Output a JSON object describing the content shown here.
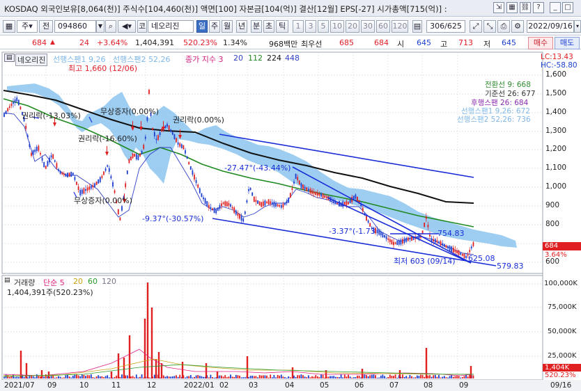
{
  "title_bar": {
    "text": "KOSDAQ 외국인보유[8,064(천)] 주식수[104,460(천)] 액면[100] 자본금[104(억)] 결산[12월] EPS[-27] 시가총액[715(억)] :",
    "icons": [
      "export-icon",
      "table-icon",
      "link-icon",
      "print-icon",
      "help-icon",
      "minimize-icon",
      "maximize-icon",
      "close-icon"
    ]
  },
  "toolbar": {
    "market_select": "주",
    "prev_label": "전",
    "code": "094860",
    "stock_prefix": "코",
    "stock_name": "네오리진",
    "periods": [
      "일",
      "주",
      "월",
      "년",
      "분",
      "초",
      "틱"
    ],
    "intervals": [
      "1",
      "3",
      "5",
      "10",
      "20",
      "30",
      "60",
      "120"
    ],
    "page_count": "306/625",
    "date": "2022/09/16"
  },
  "quote": {
    "price": "684",
    "change": "24",
    "change_pct": "+3.64%",
    "volume": "1,404,391",
    "volume_pct": "520.23%",
    "turnover": "1.34%",
    "trade_value": "968백만",
    "priority_label": "최우선",
    "ask": "685",
    "bid": "684",
    "open_label": "시",
    "open": "645",
    "high_label": "고",
    "high": "713",
    "low_label": "저",
    "low": "645",
    "buy_button": "매수",
    "sell_button": "매도"
  },
  "price_panel": {
    "stock_tag": "네오리진",
    "ichimoku_legend": [
      "선행스팬1 9,26",
      "선행스팬2 52,26"
    ],
    "ma_legend_label": "종가 지수 3",
    "ma_periods": [
      "20",
      "112",
      "224",
      "448"
    ],
    "lc": "LC:13.43",
    "hc": "HC:-58.80",
    "y_ticks": [
      "1,600",
      "1,500",
      "1,400",
      "1,300",
      "1,200",
      "1,100",
      "1,000",
      "900",
      "800",
      "700",
      "600"
    ],
    "current_price_tag": "684",
    "current_pct_tag": "3.64%",
    "ichimoku_values": [
      {
        "label": "전환선 9: 668",
        "color": "#2f8a2f"
      },
      {
        "label": "기준선 26: 677",
        "color": "#333333"
      },
      {
        "label": "후행스팬 26: 684",
        "color": "#8a2ab0"
      },
      {
        "label": "선행스팬1 9,26: 672",
        "color": "#7fb8e8"
      },
      {
        "label": "선행스팬2 52,26: 736",
        "color": "#7fb8e8"
      }
    ],
    "annotations": {
      "high": "최고 1,660 (12/06)",
      "low": "최저 603 (09/14)",
      "rights_1": "권리락(-13.03%)",
      "rights_2": "권리락(-16.60%)",
      "rights_3": "권리락(0.00%)",
      "bonus_1": "무상증자(0.00%)",
      "bonus_2": "무상증자(0.00%)",
      "trend_1": "-27.47°(-43.44%)",
      "trend_2": "-9.37°(-30.57%)",
      "trend_3": "-3.37°(-1.73",
      "level_1": "754.83",
      "level_2": "625.08",
      "level_3": "579.83"
    }
  },
  "volume_panel": {
    "legend_label": "거래량",
    "legend_ma_label": "단순 5",
    "legend_periods": [
      "20",
      "60",
      "120"
    ],
    "current": "1,404,391주(520.23%)",
    "y_ticks": [
      "100,000K",
      "75,000K",
      "50,000K",
      "25,000K"
    ],
    "vol_tag": "1,404K",
    "pct_tag": "520.23%"
  },
  "x_axis": [
    "2021/07",
    "09",
    "10",
    "11",
    "12",
    "2022/01",
    "02",
    "03",
    "04",
    "05",
    "06",
    "07",
    "08",
    "09",
    "09/16"
  ]
}
